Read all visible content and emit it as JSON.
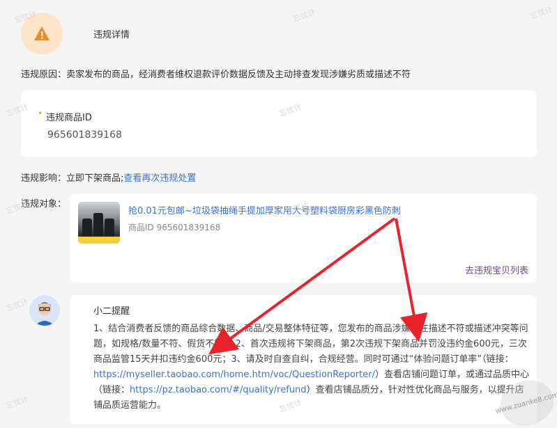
{
  "header": {
    "title": "违规详情"
  },
  "reason": {
    "label": "违规原因：",
    "text": "卖家发布的商品，经消费者维权退款评价数据反馈及主动排查发现涉嫌劣质或描述不符"
  },
  "violation_item": {
    "label": "违规商品ID",
    "value": "965601839168"
  },
  "impact": {
    "label": "违规影响：",
    "text": "立即下架商品;",
    "link": "查看再次违规处置"
  },
  "target": {
    "label": "违规对象：",
    "product_title": "抢0.01元包邮~垃圾袋抽绳手提加厚家用大号塑料袋厨房彩黑色防刺",
    "product_id": "商品ID 965601839168",
    "list_link": "去违规宝贝列表"
  },
  "tip": {
    "title": "小二提醒",
    "p1": "1、结合消费者反馈的商品综合数据、商品/交易整体特征等，您发布的商品涉嫌存在描述不符或描述冲突等问题，如规格/数量不符、假货不符。 2、首次违规将下架商品，第2次违规下架商品并罚没违约金600元，三次商品监管15天并扣违约金600元；3、请及时自查自纠，合规经营。同时可通过“体验问题订单率”（链接：",
    "link1": "https://myseller.taobao.com/home.htm/voc/QuestionReporter/",
    "p2": "）查看店铺问题订单，或通过品质中心（链接：",
    "link2": "https://pz.taobao.com/#/quality/refund",
    "p3": "）查看店铺品质分，针对性优化商品与服务，以提升店铺品质运营能力。"
  },
  "watermark": {
    "text": "忘忧计"
  },
  "stamp": {
    "text": "www.zuanke8.com"
  },
  "colors": {
    "link": "#3b6fd6",
    "warn_bg": "#fde3c8",
    "warn_icon": "#f08a24",
    "arrow": "#e8232b"
  }
}
